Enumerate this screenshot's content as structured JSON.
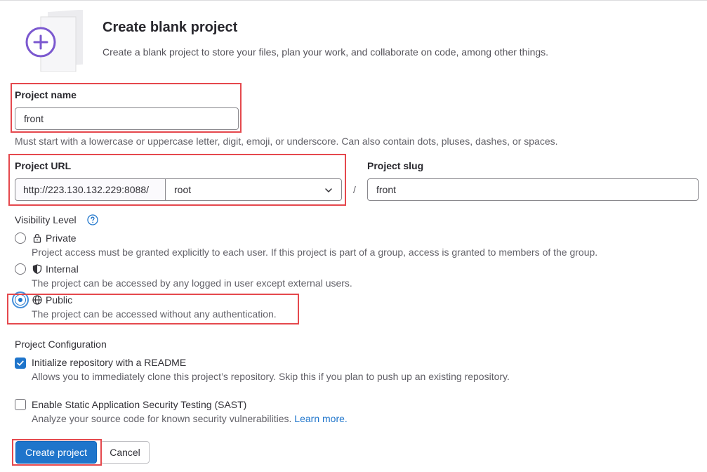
{
  "header": {
    "title": "Create blank project",
    "description": "Create a blank project to store your files, plan your work, and collaborate on code, among other things."
  },
  "project_name": {
    "label": "Project name",
    "value": "front",
    "help": "Must start with a lowercase or uppercase letter, digit, emoji, or underscore. Can also contain dots, pluses, dashes, or spaces."
  },
  "project_url": {
    "label": "Project URL",
    "prefix": "http://223.130.132.229:8088/",
    "namespace": "root",
    "separator": "/"
  },
  "project_slug": {
    "label": "Project slug",
    "value": "front"
  },
  "visibility": {
    "label": "Visibility Level",
    "selected": "public",
    "options": [
      {
        "key": "private",
        "label": "Private",
        "icon": "lock-icon",
        "help": "Project access must be granted explicitly to each user. If this project is part of a group, access is granted to members of the group."
      },
      {
        "key": "internal",
        "label": "Internal",
        "icon": "shield-icon",
        "help": "The project can be accessed by any logged in user except external users."
      },
      {
        "key": "public",
        "label": "Public",
        "icon": "globe-icon",
        "help": "The project can be accessed without any authentication."
      }
    ]
  },
  "config": {
    "label": "Project Configuration",
    "readme": {
      "checked": true,
      "label": "Initialize repository with a README",
      "help": "Allows you to immediately clone this project’s repository. Skip this if you plan to push up an existing repository."
    },
    "sast": {
      "checked": false,
      "label": "Enable Static Application Security Testing (SAST)",
      "help": "Analyze your source code for known security vulnerabilities.",
      "link": "Learn more."
    }
  },
  "actions": {
    "create": "Create project",
    "cancel": "Cancel"
  },
  "colors": {
    "accent": "#1f75cb",
    "highlight": "#e5484d",
    "illustration_purple": "#7b58cf"
  }
}
